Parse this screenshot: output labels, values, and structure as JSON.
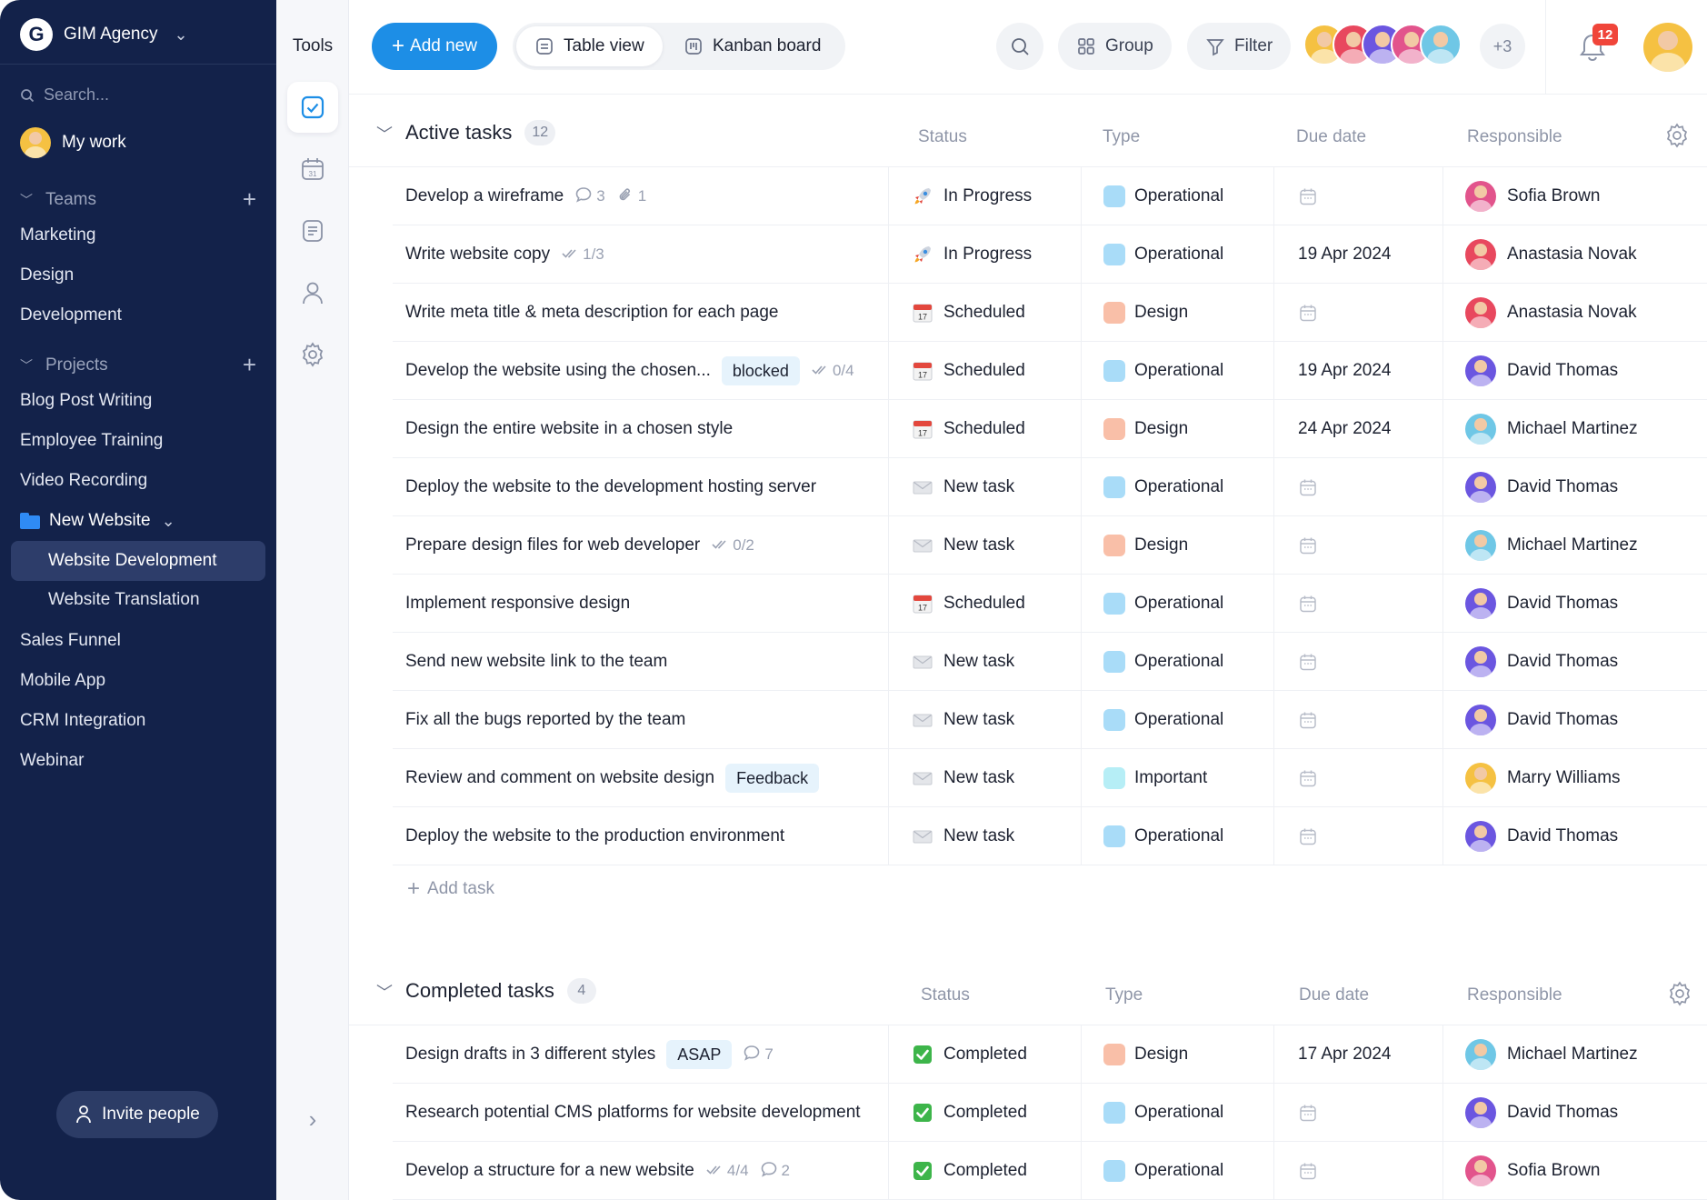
{
  "sidebar": {
    "workspace": "GIM Agency",
    "logo_letter": "G",
    "search_placeholder": "Search...",
    "my_work": "My work",
    "teams_label": "Teams",
    "teams": [
      "Marketing",
      "Design",
      "Development"
    ],
    "projects_label": "Projects",
    "projects_top": [
      "Blog Post Writing",
      "Employee Training",
      "Video Recording"
    ],
    "folder": "New Website",
    "folder_children": [
      "Website Development",
      "Website Translation"
    ],
    "active_child": "Website Development",
    "projects_bottom": [
      "Sales Funnel",
      "Mobile App",
      "CRM Integration",
      "Webinar"
    ],
    "invite": "Invite people"
  },
  "tools": {
    "title": "Tools"
  },
  "toolbar": {
    "add_new": "Add new",
    "table_view": "Table view",
    "kanban": "Kanban board",
    "group": "Group",
    "filter": "Filter",
    "more_members": "+3",
    "notifications": "12"
  },
  "columns": {
    "status": "Status",
    "type": "Type",
    "due": "Due date",
    "responsible": "Responsible"
  },
  "active": {
    "title": "Active tasks",
    "count": "12",
    "add_task": "Add task",
    "rows": [
      {
        "name": "Develop a wireframe",
        "tag": "",
        "checks": "",
        "comments": "3",
        "attachments": "1",
        "status": "In Progress",
        "status_icon": "rocket",
        "type": "Operational",
        "type_color": "#a9dcf8",
        "due": "",
        "resp": "Sofia Brown",
        "avatar": "av-pink"
      },
      {
        "name": "Write website copy",
        "tag": "",
        "checks": "1/3",
        "comments": "",
        "attachments": "",
        "status": "In Progress",
        "status_icon": "rocket",
        "type": "Operational",
        "type_color": "#a9dcf8",
        "due": "19 Apr 2024",
        "resp": "Anastasia Novak",
        "avatar": "av-red"
      },
      {
        "name": "Write meta title & meta description for each page",
        "tag": "",
        "checks": "",
        "comments": "",
        "attachments": "",
        "status": "Scheduled",
        "status_icon": "calendar",
        "type": "Design",
        "type_color": "#f9bfa8",
        "due": "",
        "resp": "Anastasia Novak",
        "avatar": "av-red"
      },
      {
        "name": "Develop the website using the chosen...",
        "tag": "blocked",
        "checks": "0/4",
        "comments": "",
        "attachments": "",
        "status": "Scheduled",
        "status_icon": "calendar",
        "type": "Operational",
        "type_color": "#a9dcf8",
        "due": "19 Apr 2024",
        "resp": "David Thomas",
        "avatar": "av-purple"
      },
      {
        "name": "Design the entire website in a chosen style",
        "tag": "",
        "checks": "",
        "comments": "",
        "attachments": "",
        "status": "Scheduled",
        "status_icon": "calendar",
        "type": "Design",
        "type_color": "#f9bfa8",
        "due": "24 Apr 2024",
        "resp": "Michael Martinez",
        "avatar": "av-teal"
      },
      {
        "name": "Deploy the website to the development hosting server",
        "tag": "",
        "checks": "",
        "comments": "",
        "attachments": "",
        "status": "New task",
        "status_icon": "envelope",
        "type": "Operational",
        "type_color": "#a9dcf8",
        "due": "",
        "resp": "David Thomas",
        "avatar": "av-purple"
      },
      {
        "name": "Prepare design files for web developer",
        "tag": "",
        "checks": "0/2",
        "comments": "",
        "attachments": "",
        "status": "New task",
        "status_icon": "envelope",
        "type": "Design",
        "type_color": "#f9bfa8",
        "due": "",
        "resp": "Michael Martinez",
        "avatar": "av-teal"
      },
      {
        "name": "Implement responsive design",
        "tag": "",
        "checks": "",
        "comments": "",
        "attachments": "",
        "status": "Scheduled",
        "status_icon": "calendar",
        "type": "Operational",
        "type_color": "#a9dcf8",
        "due": "",
        "resp": "David Thomas",
        "avatar": "av-purple"
      },
      {
        "name": "Send new website link to the team",
        "tag": "",
        "checks": "",
        "comments": "",
        "attachments": "",
        "status": "New task",
        "status_icon": "envelope",
        "type": "Operational",
        "type_color": "#a9dcf8",
        "due": "",
        "resp": "David Thomas",
        "avatar": "av-purple"
      },
      {
        "name": "Fix all the bugs reported by the team",
        "tag": "",
        "checks": "",
        "comments": "",
        "attachments": "",
        "status": "New task",
        "status_icon": "envelope",
        "type": "Operational",
        "type_color": "#a9dcf8",
        "due": "",
        "resp": "David Thomas",
        "avatar": "av-purple"
      },
      {
        "name": "Review and comment on website design",
        "tag": "Feedback",
        "checks": "",
        "comments": "",
        "attachments": "",
        "status": "New task",
        "status_icon": "envelope",
        "type": "Important",
        "type_color": "#b6eef6",
        "due": "",
        "resp": "Marry Williams",
        "avatar": "av-yellow"
      },
      {
        "name": "Deploy the website to the production environment",
        "tag": "",
        "checks": "",
        "comments": "",
        "attachments": "",
        "status": "New task",
        "status_icon": "envelope",
        "type": "Operational",
        "type_color": "#a9dcf8",
        "due": "",
        "resp": "David Thomas",
        "avatar": "av-purple"
      }
    ]
  },
  "completed": {
    "title": "Completed tasks",
    "count": "4",
    "rows": [
      {
        "name": "Design drafts in 3 different styles",
        "tag": "ASAP",
        "checks": "",
        "comments": "7",
        "attachments": "",
        "status": "Completed",
        "status_icon": "check",
        "type": "Design",
        "type_color": "#f9bfa8",
        "due": "17 Apr 2024",
        "resp": "Michael Martinez",
        "avatar": "av-teal"
      },
      {
        "name": "Research potential CMS platforms for website development",
        "tag": "",
        "checks": "",
        "comments": "",
        "attachments": "",
        "status": "Completed",
        "status_icon": "check",
        "type": "Operational",
        "type_color": "#a9dcf8",
        "due": "",
        "resp": "David Thomas",
        "avatar": "av-purple"
      },
      {
        "name": "Develop a structure for a new website",
        "tag": "",
        "checks": "4/4",
        "comments": "2",
        "attachments": "",
        "status": "Completed",
        "status_icon": "check",
        "type": "Operational",
        "type_color": "#a9dcf8",
        "due": "",
        "resp": "Sofia Brown",
        "avatar": "av-pink"
      }
    ]
  }
}
